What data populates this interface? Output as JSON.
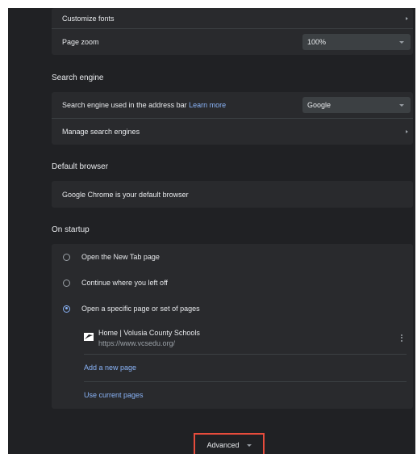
{
  "appearance": {
    "customize_fonts": "Customize fonts",
    "page_zoom_label": "Page zoom",
    "page_zoom_value": "100%"
  },
  "search_engine": {
    "title": "Search engine",
    "address_bar_label": "Search engine used in the address bar",
    "learn_more": "Learn more",
    "selected": "Google",
    "manage": "Manage search engines"
  },
  "default_browser": {
    "title": "Default browser",
    "status": "Google Chrome is your default browser"
  },
  "startup": {
    "title": "On startup",
    "options": [
      {
        "label": "Open the New Tab page",
        "selected": false
      },
      {
        "label": "Continue where you left off",
        "selected": false
      },
      {
        "label": "Open a specific page or set of pages",
        "selected": true
      }
    ],
    "pages": [
      {
        "title": "Home | Volusia County Schools",
        "url": "https://www.vcsedu.org/"
      }
    ],
    "add_page": "Add a new page",
    "use_current": "Use current pages"
  },
  "advanced": {
    "label": "Advanced"
  },
  "colors": {
    "background": "#202124",
    "card": "#292a2d",
    "link": "#8ab4f8",
    "highlight": "#e74c3c"
  }
}
